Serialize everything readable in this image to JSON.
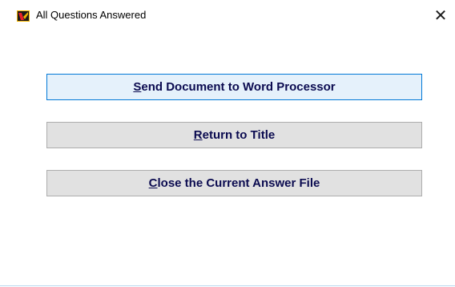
{
  "window": {
    "title": "All Questions Answered",
    "close_glyph": "✕",
    "icon": "app-logo-icon",
    "accent_color": "#0078d7"
  },
  "buttons": [
    {
      "mnemonic": "S",
      "rest": "end Document to Word Processor",
      "focused": true
    },
    {
      "mnemonic": "R",
      "rest": "eturn to Title",
      "focused": false
    },
    {
      "mnemonic": "C",
      "rest": "lose the Current Answer File",
      "focused": false
    }
  ]
}
